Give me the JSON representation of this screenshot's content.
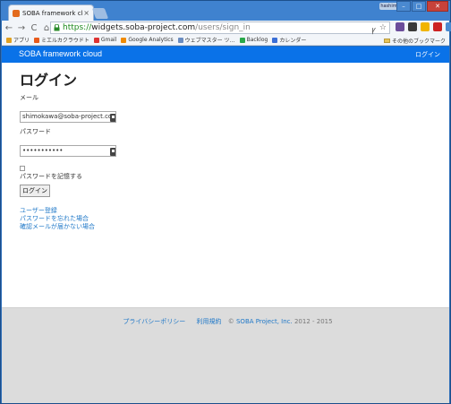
{
  "browser": {
    "tab_title": "SOBA framework cloud",
    "tab_close": "×",
    "user_name": "hashimo",
    "win_buttons": [
      "–",
      "□",
      "✕"
    ],
    "url_scheme": "https://",
    "url_host": "widgets.soba-project.com",
    "url_path": "/users/sign_in",
    "nav_icons": [
      "←",
      "→",
      "C",
      "⌂"
    ],
    "omni_icons": [
      "ꝩ",
      "☆"
    ],
    "bookmarks": [
      "アプリ",
      "ミエルカクラウドト",
      "Gmail",
      "Google Analytics",
      "ウェブマスター ツ…",
      "Backlog",
      "カレンダー"
    ],
    "other_bookmarks": "その他のブックマーク",
    "menu_icon": "≡"
  },
  "navbar": {
    "brand": "SOBA framework cloud",
    "login_link": "ログイン"
  },
  "form": {
    "title": "ログイン",
    "email_label": "メール",
    "email_value": "shimokawa@soba-project.com",
    "password_label": "パスワード",
    "password_value": "•••••••••••",
    "remember_label": "パスワードを記憶する",
    "submit_label": "ログイン"
  },
  "links": {
    "signup": "ユーザー登録",
    "forgot_password": "パスワードを忘れた場合",
    "no_confirmation": "確認メールが届かない場合"
  },
  "footer": {
    "privacy": "プライバシーポリシー",
    "terms": "利用規約",
    "copyright_prefix": "©",
    "company": "SOBA Project, Inc.",
    "years": "2012 - 2015"
  },
  "colors": {
    "navbar": "#0a72e8",
    "link": "#1f78c8",
    "footer_bg": "#dcdcdc"
  }
}
